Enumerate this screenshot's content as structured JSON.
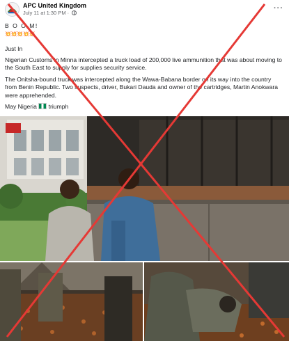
{
  "post": {
    "page_name": "APC United Kingdom",
    "timestamp": "July 11 at 1:30 PM",
    "separator": "·",
    "more_icon": "ellipsis-icon",
    "privacy_icon": "globe-icon"
  },
  "content": {
    "line1": "B O O M!",
    "line1_emoji": "💥💥💥💥💥",
    "line2": "Just In",
    "para1": "Nigerian Customs in Minna intercepted a truck load of 200,000 live ammunition that was about moving to the South East to supply for supplies security service.",
    "para2": "The Onitsha-bound truck was intercepted along the Wawa-Babana border on its way into the country from Benin Republic. Two suspects, driver, Bukari Dauda and owner of the cartridges, Martin Anokwara were apprehended.",
    "para3": "May Nigeria",
    "para3_end": "triumph"
  },
  "overlay": {
    "cross_color": "#e53935"
  }
}
